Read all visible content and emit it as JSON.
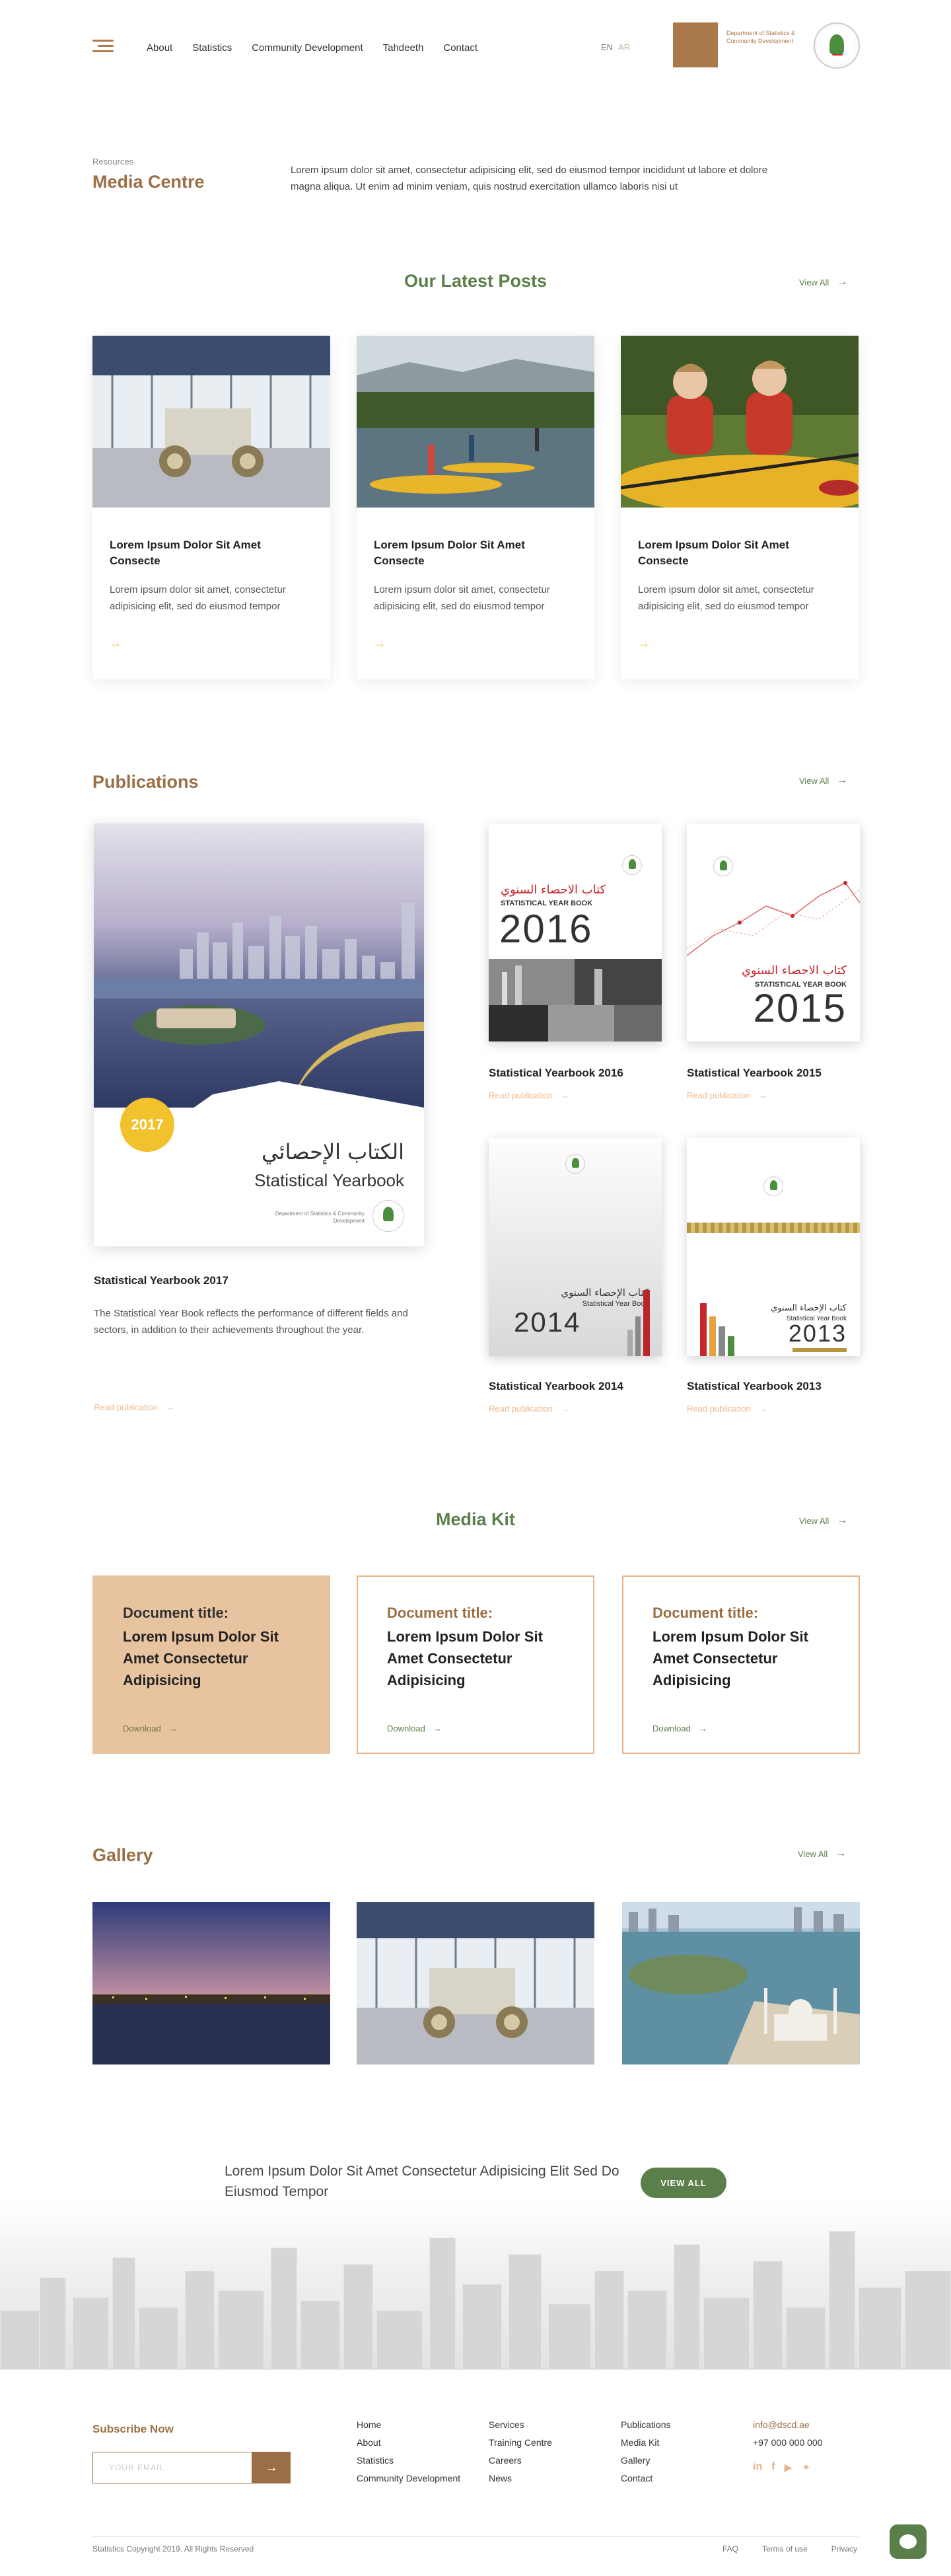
{
  "header": {
    "nav": [
      "About",
      "Statistics",
      "Community Development",
      "Tahdeeth",
      "Contact"
    ],
    "lang_en": "EN",
    "lang_ar": "AR",
    "logo_text": "Department of Statistics & Community Development"
  },
  "hero": {
    "crumb": "Resources",
    "title": "Media Centre",
    "intro": "Lorem ipsum dolor sit amet, consectetur adipisicing elit, sed do eiusmod tempor incididunt ut labore et dolore magna aliqua. Ut enim ad minim veniam, quis nostrud exercitation ullamco laboris nisi ut"
  },
  "posts": {
    "title": "Our Latest Posts",
    "view_all": "View All",
    "items": [
      {
        "title": "Lorem Ipsum Dolor Sit Amet Consecte",
        "text": "Lorem ipsum dolor sit amet, consectetur adipisicing elit, sed do eiusmod tempor"
      },
      {
        "title": "Lorem Ipsum Dolor Sit Amet Consecte",
        "text": "Lorem ipsum dolor sit amet, consectetur adipisicing elit, sed do eiusmod tempor"
      },
      {
        "title": "Lorem Ipsum Dolor Sit Amet Consecte",
        "text": "Lorem ipsum dolor sit amet, consectetur adipisicing elit, sed do eiusmod tempor"
      }
    ]
  },
  "publications": {
    "title": "Publications",
    "view_all": "View All",
    "read_label": "Read publication",
    "featured": {
      "year": "2017",
      "cover_ar": "الكتاب الإحصائي",
      "cover_en": "Statistical Yearbook",
      "cover_org": "Department of Statistics & Community Development",
      "title": "Statistical Yearbook 2017",
      "desc": "The Statistical Year Book reflects the performance of different fields and sectors, in addition to their achievements throughout the year."
    },
    "books": [
      {
        "title": "Statistical Yearbook 2016",
        "year": "2016",
        "cover_ar": "كتاب الاحصاء السنوي",
        "cover_en": "STATISTICAL YEAR BOOK"
      },
      {
        "title": "Statistical Yearbook 2015",
        "year": "2015",
        "cover_ar": "كتاب الاحصاء السنوي",
        "cover_en": "STATISTICAL YEAR BOOK"
      },
      {
        "title": "Statistical Yearbook 2014",
        "year": "2014",
        "cover_ar": "كتاب الإحصاء السنوي",
        "cover_en": "Statistical Year Book"
      },
      {
        "title": "Statistical Yearbook 2013",
        "year": "2013",
        "cover_ar": "كتاب الإحصاء السنوي",
        "cover_en": "Statistical Year Book"
      }
    ]
  },
  "mediakit": {
    "title": "Media Kit",
    "view_all": "View All",
    "items": [
      {
        "label": "Document title:",
        "name": "Lorem Ipsum Dolor Sit Amet Consectetur Adipisicing",
        "download": "Download"
      },
      {
        "label": "Document title:",
        "name": "Lorem Ipsum Dolor Sit Amet Consectetur Adipisicing",
        "download": "Download"
      },
      {
        "label": "Document title:",
        "name": "Lorem Ipsum Dolor Sit Amet Consectetur Adipisicing",
        "download": "Download"
      }
    ]
  },
  "gallery": {
    "title": "Gallery",
    "view_all": "View All"
  },
  "cta": {
    "text": "Lorem Ipsum Dolor Sit Amet Consectetur Adipisicing Elit Sed Do Eiusmod Tempor",
    "button": "VIEW ALL"
  },
  "footer": {
    "subscribe_title": "Subscribe Now",
    "email_placeholder": "YOUR EMAIL",
    "col1": [
      "Home",
      "About",
      "Statistics",
      "Community Development"
    ],
    "col2": [
      "Services",
      "Training Centre",
      "Careers",
      "News"
    ],
    "col3": [
      "Publications",
      "Media Kit",
      "Gallery",
      "Contact"
    ],
    "email": "info@dscd.ae",
    "phone": "+97 000 000 000",
    "copyright": "Statistics Copyright 2019. All Rights Reserved",
    "links": [
      "FAQ",
      "Terms of use",
      "Privacy"
    ]
  },
  "colors": {
    "brand_brown": "#9b6f45",
    "brand_green": "#5b7f4a",
    "accent_peach": "#e8c3a0"
  }
}
